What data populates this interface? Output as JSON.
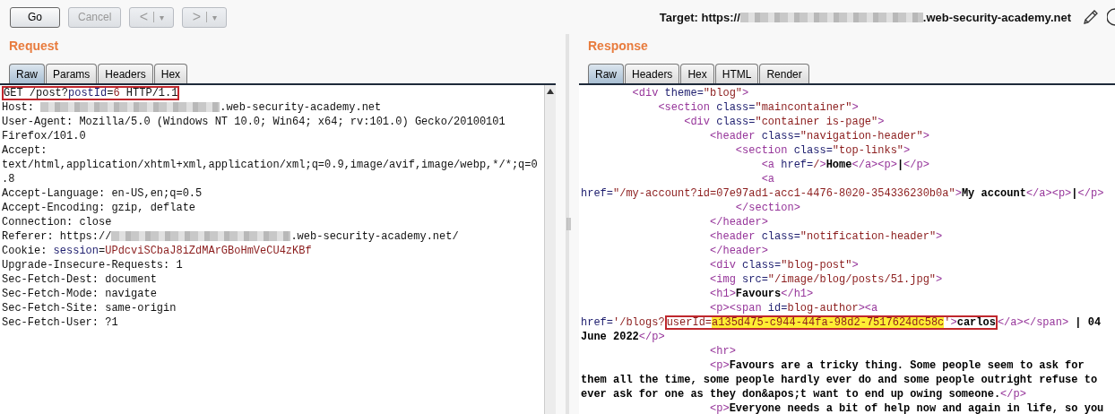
{
  "toolbar": {
    "buttons": [
      {
        "kind": "text",
        "label": "Go",
        "disabled": false
      },
      {
        "kind": "text",
        "label": "Cancel",
        "disabled": true
      },
      {
        "kind": "nav",
        "label": "<",
        "caret": "▾",
        "disabled": true
      },
      {
        "kind": "nav",
        "label": ">",
        "caret": "▾",
        "disabled": true
      }
    ],
    "target": {
      "prefix": "Target: https://",
      "suffix": ".web-security-academy.net"
    }
  },
  "request": {
    "title": "Request",
    "tabs": [
      {
        "label": "Raw",
        "selected": true
      },
      {
        "label": "Params",
        "selected": false
      },
      {
        "label": "Headers",
        "selected": false
      },
      {
        "label": "Hex",
        "selected": false
      }
    ],
    "lines": [
      [
        {
          "kind": "boxed",
          "children": [
            {
              "kind": "plain",
              "text": "GET /post?"
            },
            {
              "kind": "name",
              "text": "postId"
            },
            {
              "kind": "plain",
              "text": "="
            },
            {
              "kind": "value",
              "text": "6"
            },
            {
              "kind": "plain",
              "text": " HTTP/1.1"
            }
          ]
        }
      ],
      [
        {
          "kind": "plain",
          "text": "Host: "
        },
        {
          "kind": "redacted"
        },
        {
          "kind": "plain",
          "text": ".web-security-academy.net"
        }
      ],
      [
        {
          "kind": "plain",
          "text": "User-Agent: Mozilla/5.0 (Windows NT 10.0; Win64; x64; rv:101.0) Gecko/20100101"
        }
      ],
      [
        {
          "kind": "plain",
          "text": "Firefox/101.0"
        }
      ],
      [
        {
          "kind": "plain",
          "text": "Accept:"
        }
      ],
      [
        {
          "kind": "plain",
          "text": "text/html,application/xhtml+xml,application/xml;q=0.9,image/avif,image/webp,*/*;q=0"
        }
      ],
      [
        {
          "kind": "plain",
          "text": ".8"
        }
      ],
      [
        {
          "kind": "plain",
          "text": "Accept-Language: en-US,en;q=0.5"
        }
      ],
      [
        {
          "kind": "plain",
          "text": "Accept-Encoding: gzip, deflate"
        }
      ],
      [
        {
          "kind": "plain",
          "text": "Connection: close"
        }
      ],
      [
        {
          "kind": "plain",
          "text": "Referer: https://"
        },
        {
          "kind": "redacted"
        },
        {
          "kind": "plain",
          "text": ".web-security-academy.net/"
        }
      ],
      [
        {
          "kind": "plain",
          "text": "Cookie: "
        },
        {
          "kind": "name",
          "text": "session"
        },
        {
          "kind": "plain",
          "text": "="
        },
        {
          "kind": "value",
          "text": "UPdcviSCbaJ8iZdMArGBoHmVeCU4zKBf"
        }
      ],
      [
        {
          "kind": "plain",
          "text": "Upgrade-Insecure-Requests: 1"
        }
      ],
      [
        {
          "kind": "plain",
          "text": "Sec-Fetch-Dest: document"
        }
      ],
      [
        {
          "kind": "plain",
          "text": "Sec-Fetch-Mode: navigate"
        }
      ],
      [
        {
          "kind": "plain",
          "text": "Sec-Fetch-Site: same-origin"
        }
      ],
      [
        {
          "kind": "plain",
          "text": "Sec-Fetch-User: ?1"
        }
      ]
    ]
  },
  "response": {
    "title": "Response",
    "tabs": [
      {
        "label": "Raw",
        "selected": true
      },
      {
        "label": "Headers",
        "selected": false
      },
      {
        "label": "Hex",
        "selected": false
      },
      {
        "label": "HTML",
        "selected": false
      },
      {
        "label": "Render",
        "selected": false
      }
    ],
    "lines": [
      [
        {
          "kind": "tag",
          "text": "        <div"
        },
        {
          "kind": "name",
          "text": " theme="
        },
        {
          "kind": "value",
          "text": "\"blog\""
        },
        {
          "kind": "tag",
          "text": ">"
        }
      ],
      [
        {
          "kind": "tag",
          "text": "            <section"
        },
        {
          "kind": "name",
          "text": " class="
        },
        {
          "kind": "value",
          "text": "\"maincontainer\""
        },
        {
          "kind": "tag",
          "text": ">"
        }
      ],
      [
        {
          "kind": "tag",
          "text": "                <div"
        },
        {
          "kind": "name",
          "text": " class="
        },
        {
          "kind": "value",
          "text": "\"container is-page\""
        },
        {
          "kind": "tag",
          "text": ">"
        }
      ],
      [
        {
          "kind": "tag",
          "text": "                    <header"
        },
        {
          "kind": "name",
          "text": " class="
        },
        {
          "kind": "value",
          "text": "\"navigation-header\""
        },
        {
          "kind": "tag",
          "text": ">"
        }
      ],
      [
        {
          "kind": "tag",
          "text": "                        <section"
        },
        {
          "kind": "name",
          "text": " class="
        },
        {
          "kind": "value",
          "text": "\"top-links\""
        },
        {
          "kind": "tag",
          "text": ">"
        }
      ],
      [
        {
          "kind": "tag",
          "text": "                            <a"
        },
        {
          "kind": "name",
          "text": " href="
        },
        {
          "kind": "value",
          "text": "/"
        },
        {
          "kind": "tag",
          "text": ">"
        },
        {
          "kind": "bold",
          "text": "Home"
        },
        {
          "kind": "tag",
          "text": "</a><p>"
        },
        {
          "kind": "bold",
          "text": "|"
        },
        {
          "kind": "tag",
          "text": "</p>"
        }
      ],
      [
        {
          "kind": "tag",
          "text": "                            <a"
        }
      ],
      [
        {
          "kind": "name",
          "text": "href="
        },
        {
          "kind": "value",
          "text": "\"/my-account?id=07e97ad1-acc1-4476-8020-354336230b0a\""
        },
        {
          "kind": "tag",
          "text": ">"
        },
        {
          "kind": "bold",
          "text": "My account"
        },
        {
          "kind": "tag",
          "text": "</a><p>"
        },
        {
          "kind": "bold",
          "text": "|"
        },
        {
          "kind": "tag",
          "text": "</p>"
        }
      ],
      [
        {
          "kind": "tag",
          "text": "                        </section>"
        }
      ],
      [
        {
          "kind": "tag",
          "text": "                    </header>"
        }
      ],
      [
        {
          "kind": "tag",
          "text": "                    <header"
        },
        {
          "kind": "name",
          "text": " class="
        },
        {
          "kind": "value",
          "text": "\"notification-header\""
        },
        {
          "kind": "tag",
          "text": ">"
        }
      ],
      [
        {
          "kind": "tag",
          "text": "                    </header>"
        }
      ],
      [
        {
          "kind": "tag",
          "text": "                    <div"
        },
        {
          "kind": "name",
          "text": " class="
        },
        {
          "kind": "value",
          "text": "\"blog-post\""
        },
        {
          "kind": "tag",
          "text": ">"
        }
      ],
      [
        {
          "kind": "tag",
          "text": "                    <img"
        },
        {
          "kind": "name",
          "text": " src="
        },
        {
          "kind": "value",
          "text": "\"/image/blog/posts/51.jpg\""
        },
        {
          "kind": "tag",
          "text": ">"
        }
      ],
      [
        {
          "kind": "tag",
          "text": "                    <h1>"
        },
        {
          "kind": "bold",
          "text": "Favours"
        },
        {
          "kind": "tag",
          "text": "</h1>"
        }
      ],
      [
        {
          "kind": "tag",
          "text": "                    <p><span"
        },
        {
          "kind": "name",
          "text": " id="
        },
        {
          "kind": "value",
          "text": "blog-author"
        },
        {
          "kind": "tag",
          "text": "><a"
        }
      ],
      [
        {
          "kind": "name",
          "text": "href="
        },
        {
          "kind": "value",
          "text": "'/blogs?"
        },
        {
          "kind": "boxed",
          "children": [
            {
              "kind": "value",
              "text": "userId="
            },
            {
              "kind": "highlight",
              "text": "a135d475-c944-44fa-98d2-7517624dc58c"
            },
            {
              "kind": "value",
              "text": "'"
            },
            {
              "kind": "tag",
              "text": ">"
            },
            {
              "kind": "bold",
              "text": "carlos"
            }
          ]
        },
        {
          "kind": "tag",
          "text": "</a></span>"
        },
        {
          "kind": "bold",
          "text": " | 04"
        }
      ],
      [
        {
          "kind": "bold",
          "text": "June 2022"
        },
        {
          "kind": "tag",
          "text": "</p>"
        }
      ],
      [
        {
          "kind": "tag",
          "text": "                    <hr>"
        }
      ],
      [
        {
          "kind": "tag",
          "text": "                    <p>"
        },
        {
          "kind": "bold",
          "text": "Favours are a tricky thing. Some people seem to ask for"
        }
      ],
      [
        {
          "kind": "bold",
          "text": "them all the time, some people hardly ever do and some people outright refuse to"
        }
      ],
      [
        {
          "kind": "bold",
          "text": "ever ask for one as they don&apos;t want to end up owing someone."
        },
        {
          "kind": "tag",
          "text": "</p>"
        }
      ],
      [
        {
          "kind": "tag",
          "text": "                    <p>"
        },
        {
          "kind": "bold",
          "text": "Everyone needs a bit of help now and again in life, so you"
        }
      ]
    ]
  }
}
